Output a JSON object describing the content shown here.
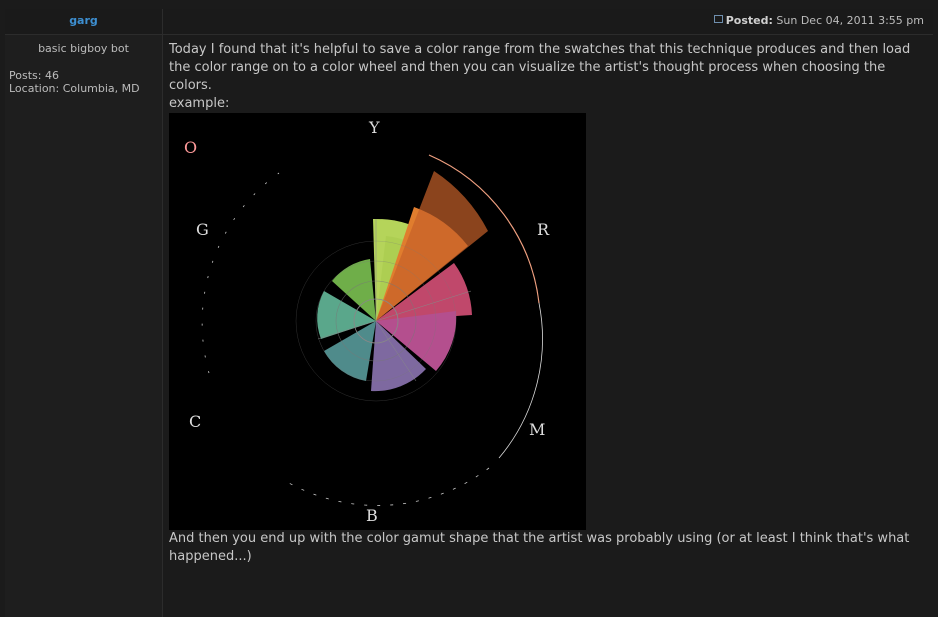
{
  "author": {
    "name": "garg",
    "rank": "basic bigboy bot",
    "posts": "Posts: 46",
    "location": "Location: Columbia, MD"
  },
  "post": {
    "posted_label": "Posted:",
    "posted_date": "Sun Dec 04, 2011 3:55 pm",
    "paragraph1": "Today I found that it's helpful to save a color range from the swatches that this technique produces and then load the color range on to a color wheel and then you can visualize the artist's thought process when choosing the colors.",
    "example_label": "example:",
    "paragraph2": "And then you end up with the color gamut shape that the artist was probably using (or at least I think that's what happened...)"
  },
  "wheel": {
    "labels": [
      "Y",
      "R",
      "M",
      "B",
      "C",
      "G",
      "O"
    ]
  }
}
